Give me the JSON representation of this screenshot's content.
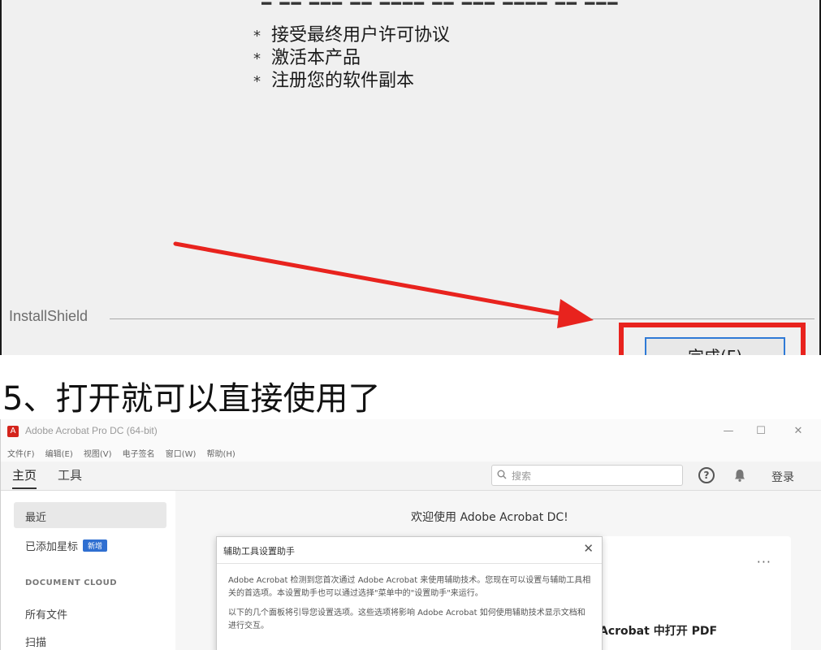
{
  "installer": {
    "bullets": [
      "接受最终用户许可协议",
      "激活本产品",
      "注册您的软件副本"
    ],
    "bullet_marker": "*",
    "brand": "InstallShield",
    "finish_button": "完成(F)"
  },
  "step_title": "5、打开就可以直接使用了",
  "acrobat": {
    "window_title": "Adobe Acrobat Pro DC (64-bit)",
    "window_controls": [
      "—",
      "☐",
      "✕"
    ],
    "menu": [
      "文件(F)",
      "编辑(E)",
      "视图(V)",
      "电子签名",
      "窗口(W)",
      "帮助(H)"
    ],
    "tabs": [
      "主页",
      "工具"
    ],
    "search_placeholder": "搜索",
    "login": "登录",
    "sidebar": {
      "recent": "最近",
      "starred": "已添加星标",
      "new_badge": "新增",
      "section_heading": "DOCUMENT CLOUD",
      "all_files": "所有文件",
      "scan": "扫描"
    },
    "welcome": "欢迎使用 Adobe Acrobat DC!",
    "card": {
      "more": "···",
      "text": "Acrobat 中打开 PDF"
    },
    "dialog": {
      "title": "辅助工具设置助手",
      "close": "✕",
      "paragraph1": "Adobe Acrobat 检测到您首次通过 Adobe Acrobat 来使用辅助技术。您现在可以设置与辅助工具相关的首选项。本设置助手也可以通过选择\"菜单中的\"设置助手\"来运行。",
      "paragraph2": "以下的几个面板将引导您设置选项。这些选项将影响 Adobe Acrobat 如何使用辅助技术显示文档和进行交互。"
    }
  },
  "colors": {
    "highlight_red": "#e8231e",
    "accent_blue": "#2f6fd1",
    "acrobat_red": "#d4241c"
  }
}
